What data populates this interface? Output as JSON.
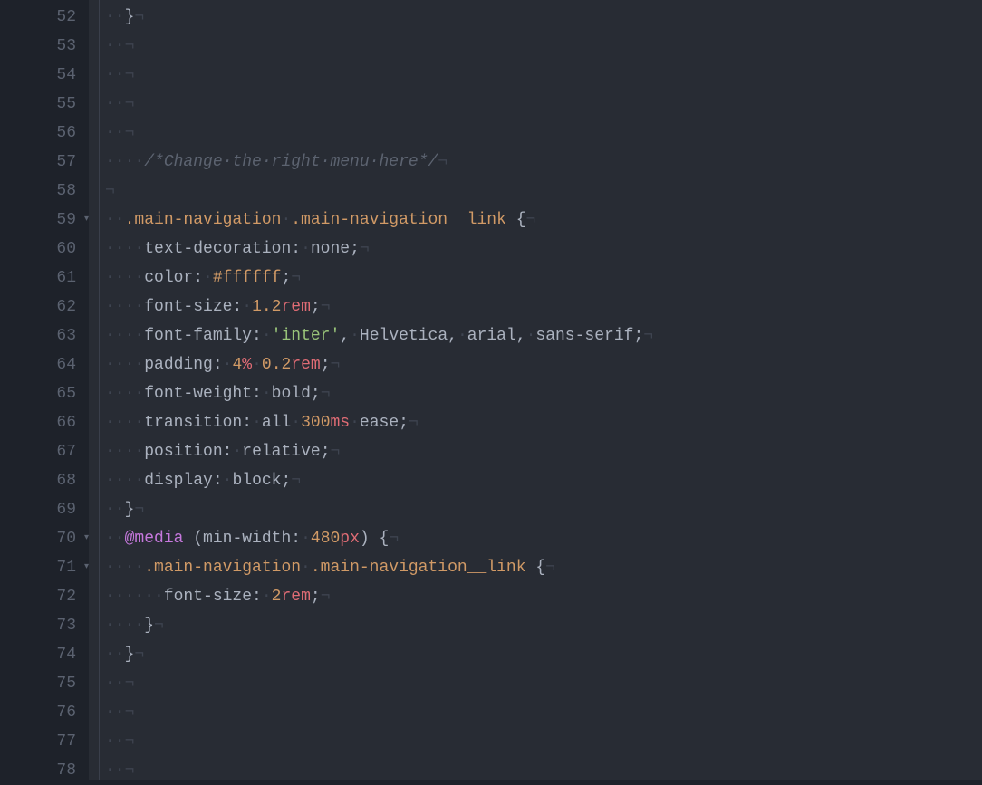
{
  "editor": {
    "gutter": {
      "start": 52,
      "end": 78,
      "fold_markers": [
        59,
        70,
        71
      ]
    },
    "whitespace_dot": "·",
    "eol_char": "¬",
    "indent_guide": "",
    "lines": [
      {
        "n": 52,
        "tokens": [
          {
            "t": "ws",
            "v": "··"
          },
          {
            "t": "brace",
            "v": "}"
          },
          {
            "t": "eol",
            "v": "¬"
          }
        ]
      },
      {
        "n": 53,
        "tokens": [
          {
            "t": "ws",
            "v": "··"
          },
          {
            "t": "eol",
            "v": "¬"
          }
        ]
      },
      {
        "n": 54,
        "tokens": [
          {
            "t": "ws",
            "v": "··"
          },
          {
            "t": "eol",
            "v": "¬"
          }
        ]
      },
      {
        "n": 55,
        "tokens": [
          {
            "t": "ws",
            "v": "··"
          },
          {
            "t": "eol",
            "v": "¬"
          }
        ]
      },
      {
        "n": 56,
        "tokens": [
          {
            "t": "ws",
            "v": "··"
          },
          {
            "t": "eol",
            "v": "¬"
          }
        ]
      },
      {
        "n": 57,
        "tokens": [
          {
            "t": "ws",
            "v": "····"
          },
          {
            "t": "comment",
            "v": "/*Change·the·right·menu·here*/"
          },
          {
            "t": "eol",
            "v": "¬"
          }
        ]
      },
      {
        "n": 58,
        "tokens": [
          {
            "t": "eol",
            "v": "¬"
          }
        ]
      },
      {
        "n": 59,
        "tokens": [
          {
            "t": "ws",
            "v": "··"
          },
          {
            "t": "sel",
            "v": ".main-navigation"
          },
          {
            "t": "ws",
            "v": "·"
          },
          {
            "t": "sel",
            "v": ".main-navigation__link"
          },
          {
            "t": "plain",
            "v": " "
          },
          {
            "t": "brace",
            "v": "{"
          },
          {
            "t": "eol",
            "v": "¬"
          }
        ]
      },
      {
        "n": 60,
        "tokens": [
          {
            "t": "ws",
            "v": "····"
          },
          {
            "t": "prop",
            "v": "text-decoration"
          },
          {
            "t": "colon",
            "v": ":"
          },
          {
            "t": "ws",
            "v": "·"
          },
          {
            "t": "plain",
            "v": "none"
          },
          {
            "t": "semi",
            "v": ";"
          },
          {
            "t": "eol",
            "v": "¬"
          }
        ]
      },
      {
        "n": 61,
        "tokens": [
          {
            "t": "ws",
            "v": "····"
          },
          {
            "t": "prop",
            "v": "color"
          },
          {
            "t": "colon",
            "v": ":"
          },
          {
            "t": "ws",
            "v": "·"
          },
          {
            "t": "colorv",
            "v": "#ffffff"
          },
          {
            "t": "semi",
            "v": ";"
          },
          {
            "t": "eol",
            "v": "¬"
          }
        ]
      },
      {
        "n": 62,
        "tokens": [
          {
            "t": "ws",
            "v": "····"
          },
          {
            "t": "prop",
            "v": "font-size"
          },
          {
            "t": "colon",
            "v": ":"
          },
          {
            "t": "ws",
            "v": "·"
          },
          {
            "t": "num",
            "v": "1.2"
          },
          {
            "t": "unit",
            "v": "rem"
          },
          {
            "t": "semi",
            "v": ";"
          },
          {
            "t": "eol",
            "v": "¬"
          }
        ]
      },
      {
        "n": 63,
        "tokens": [
          {
            "t": "ws",
            "v": "····"
          },
          {
            "t": "prop",
            "v": "font-family"
          },
          {
            "t": "colon",
            "v": ":"
          },
          {
            "t": "ws",
            "v": "·"
          },
          {
            "t": "str",
            "v": "'inter'"
          },
          {
            "t": "punct",
            "v": ","
          },
          {
            "t": "ws",
            "v": "·"
          },
          {
            "t": "plain",
            "v": "Helvetica"
          },
          {
            "t": "punct",
            "v": ","
          },
          {
            "t": "ws",
            "v": "·"
          },
          {
            "t": "plain",
            "v": "arial"
          },
          {
            "t": "punct",
            "v": ","
          },
          {
            "t": "ws",
            "v": "·"
          },
          {
            "t": "plain",
            "v": "sans-serif"
          },
          {
            "t": "semi",
            "v": ";"
          },
          {
            "t": "eol",
            "v": "¬"
          }
        ]
      },
      {
        "n": 64,
        "tokens": [
          {
            "t": "ws",
            "v": "····"
          },
          {
            "t": "prop",
            "v": "padding"
          },
          {
            "t": "colon",
            "v": ":"
          },
          {
            "t": "ws",
            "v": "·"
          },
          {
            "t": "num",
            "v": "4"
          },
          {
            "t": "unit",
            "v": "%"
          },
          {
            "t": "ws",
            "v": "·"
          },
          {
            "t": "num",
            "v": "0.2"
          },
          {
            "t": "unit",
            "v": "rem"
          },
          {
            "t": "semi",
            "v": ";"
          },
          {
            "t": "eol",
            "v": "¬"
          }
        ]
      },
      {
        "n": 65,
        "tokens": [
          {
            "t": "ws",
            "v": "····"
          },
          {
            "t": "prop",
            "v": "font-weight"
          },
          {
            "t": "colon",
            "v": ":"
          },
          {
            "t": "ws",
            "v": "·"
          },
          {
            "t": "plain",
            "v": "bold"
          },
          {
            "t": "semi",
            "v": ";"
          },
          {
            "t": "eol",
            "v": "¬"
          }
        ]
      },
      {
        "n": 66,
        "tokens": [
          {
            "t": "ws",
            "v": "····"
          },
          {
            "t": "prop",
            "v": "transition"
          },
          {
            "t": "colon",
            "v": ":"
          },
          {
            "t": "ws",
            "v": "·"
          },
          {
            "t": "plain",
            "v": "all"
          },
          {
            "t": "ws",
            "v": "·"
          },
          {
            "t": "num",
            "v": "300"
          },
          {
            "t": "unit",
            "v": "ms"
          },
          {
            "t": "ws",
            "v": "·"
          },
          {
            "t": "plain",
            "v": "ease"
          },
          {
            "t": "semi",
            "v": ";"
          },
          {
            "t": "eol",
            "v": "¬"
          }
        ]
      },
      {
        "n": 67,
        "tokens": [
          {
            "t": "ws",
            "v": "····"
          },
          {
            "t": "prop",
            "v": "position"
          },
          {
            "t": "colon",
            "v": ":"
          },
          {
            "t": "ws",
            "v": "·"
          },
          {
            "t": "plain",
            "v": "relative"
          },
          {
            "t": "semi",
            "v": ";"
          },
          {
            "t": "eol",
            "v": "¬"
          }
        ]
      },
      {
        "n": 68,
        "tokens": [
          {
            "t": "ws",
            "v": "····"
          },
          {
            "t": "prop",
            "v": "display"
          },
          {
            "t": "colon",
            "v": ":"
          },
          {
            "t": "ws",
            "v": "·"
          },
          {
            "t": "plain",
            "v": "block"
          },
          {
            "t": "semi",
            "v": ";"
          },
          {
            "t": "eol",
            "v": "¬"
          }
        ]
      },
      {
        "n": 69,
        "tokens": [
          {
            "t": "ws",
            "v": "··"
          },
          {
            "t": "brace",
            "v": "}"
          },
          {
            "t": "eol",
            "v": "¬"
          }
        ]
      },
      {
        "n": 70,
        "tokens": [
          {
            "t": "ws",
            "v": "··"
          },
          {
            "t": "at",
            "v": "@media"
          },
          {
            "t": "plain",
            "v": " "
          },
          {
            "t": "brace",
            "v": "("
          },
          {
            "t": "mq",
            "v": "min-width"
          },
          {
            "t": "colon",
            "v": ":"
          },
          {
            "t": "ws",
            "v": "·"
          },
          {
            "t": "num",
            "v": "480"
          },
          {
            "t": "unit",
            "v": "px"
          },
          {
            "t": "brace",
            "v": ")"
          },
          {
            "t": "plain",
            "v": " "
          },
          {
            "t": "brace",
            "v": "{"
          },
          {
            "t": "eol",
            "v": "¬"
          }
        ]
      },
      {
        "n": 71,
        "tokens": [
          {
            "t": "ws",
            "v": "····"
          },
          {
            "t": "sel",
            "v": ".main-navigation"
          },
          {
            "t": "ws",
            "v": "·"
          },
          {
            "t": "sel",
            "v": ".main-navigation__link"
          },
          {
            "t": "plain",
            "v": " "
          },
          {
            "t": "brace",
            "v": "{"
          },
          {
            "t": "eol",
            "v": "¬"
          }
        ]
      },
      {
        "n": 72,
        "tokens": [
          {
            "t": "ws",
            "v": "······"
          },
          {
            "t": "prop",
            "v": "font-size"
          },
          {
            "t": "colon",
            "v": ":"
          },
          {
            "t": "ws",
            "v": "·"
          },
          {
            "t": "num",
            "v": "2"
          },
          {
            "t": "unit",
            "v": "rem"
          },
          {
            "t": "semi",
            "v": ";"
          },
          {
            "t": "eol",
            "v": "¬"
          }
        ]
      },
      {
        "n": 73,
        "tokens": [
          {
            "t": "ws",
            "v": "····"
          },
          {
            "t": "brace",
            "v": "}"
          },
          {
            "t": "eol",
            "v": "¬"
          }
        ]
      },
      {
        "n": 74,
        "tokens": [
          {
            "t": "ws",
            "v": "··"
          },
          {
            "t": "brace",
            "v": "}"
          },
          {
            "t": "eol",
            "v": "¬"
          }
        ]
      },
      {
        "n": 75,
        "tokens": [
          {
            "t": "ws",
            "v": "··"
          },
          {
            "t": "eol",
            "v": "¬"
          }
        ]
      },
      {
        "n": 76,
        "tokens": [
          {
            "t": "ws",
            "v": "··"
          },
          {
            "t": "eol",
            "v": "¬"
          }
        ]
      },
      {
        "n": 77,
        "tokens": [
          {
            "t": "ws",
            "v": "··"
          },
          {
            "t": "eol",
            "v": "¬"
          }
        ]
      },
      {
        "n": 78,
        "tokens": [
          {
            "t": "ws",
            "v": "··"
          },
          {
            "t": "eol",
            "v": "¬"
          }
        ]
      }
    ]
  }
}
